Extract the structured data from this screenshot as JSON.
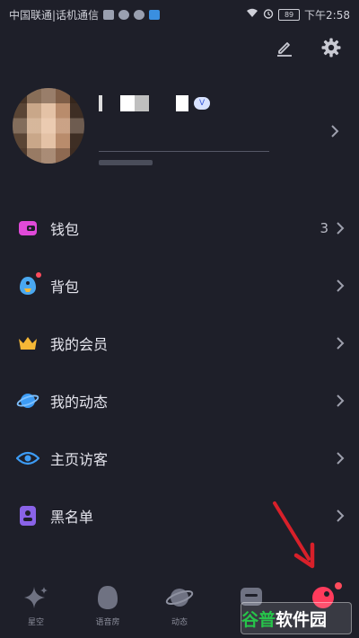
{
  "status_bar": {
    "carrier": "中国联通|话机通信",
    "time": "下午2:58",
    "battery": "89"
  },
  "header": {
    "edit_icon": "pencil-icon",
    "settings_icon": "gear-icon"
  },
  "profile": {
    "vip_tag": "V"
  },
  "menu": [
    {
      "label": "钱包",
      "icon": "wallet-icon",
      "count": "3",
      "color": "#e14ad9"
    },
    {
      "label": "背包",
      "icon": "backpack-icon",
      "count": "",
      "color": "#4aa8f0",
      "badge": true
    },
    {
      "label": "我的会员",
      "icon": "crown-icon",
      "count": "",
      "color": "#f5b736"
    },
    {
      "label": "我的动态",
      "icon": "planet-icon",
      "count": "",
      "color": "#3d9cf5"
    },
    {
      "label": "主页访客",
      "icon": "eye-icon",
      "count": "",
      "color": "#3d9cf5"
    },
    {
      "label": "黑名单",
      "icon": "blacklist-icon",
      "count": "",
      "color": "#8a63e8"
    }
  ],
  "tabbar": [
    {
      "label": "星空",
      "icon": "sparkle-icon"
    },
    {
      "label": "语音房",
      "icon": "voice-room-icon"
    },
    {
      "label": "动态",
      "icon": "planet-icon"
    },
    {
      "label": "",
      "icon": "message-icon"
    },
    {
      "label": "",
      "icon": "profile-icon",
      "badge": true
    }
  ],
  "watermark": {
    "part1": "谷普",
    "part2": "软件园"
  },
  "colors": {
    "background": "#1e1f29",
    "accent_red": "#ff4b5c",
    "arrow_red": "#d8202a"
  }
}
